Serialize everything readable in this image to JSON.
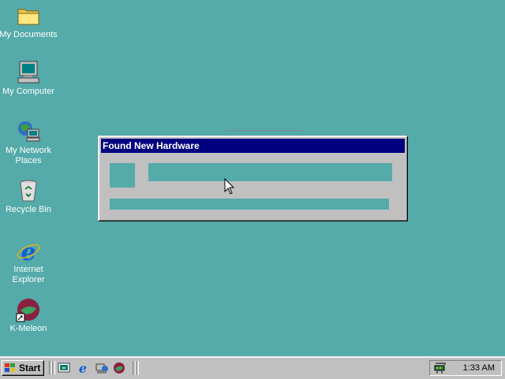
{
  "desktop": {
    "background": "#55aaaa",
    "icons": [
      {
        "label": "My Documents",
        "icon": "folder-icon"
      },
      {
        "label": "My Computer",
        "icon": "computer-icon"
      },
      {
        "label": "My Network Places",
        "icon": "network-icon"
      },
      {
        "label": "Recycle Bin",
        "icon": "recycle-bin-icon"
      },
      {
        "label": "Internet Explorer",
        "icon": "ie-icon"
      },
      {
        "label": "K-Meleon",
        "icon": "k-meleon-icon"
      }
    ]
  },
  "dialog": {
    "title": "Found New Hardware",
    "title_color": "#000080"
  },
  "taskbar": {
    "start_label": "Start",
    "quick_launch": [
      "desktop-icon",
      "ie-icon",
      "channels-icon",
      "k-meleon-icon"
    ],
    "clock": "1:33 AM"
  }
}
